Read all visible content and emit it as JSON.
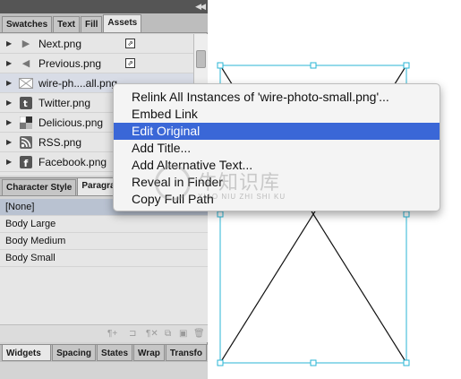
{
  "top_tabs": [
    {
      "label": "Swatches",
      "active": false
    },
    {
      "label": "Text",
      "active": false
    },
    {
      "label": "Fill",
      "active": false
    },
    {
      "label": "Assets",
      "active": true
    }
  ],
  "assets": [
    {
      "label": "Next.png",
      "icon": "play-arrow-icon",
      "linked": true,
      "selected": false
    },
    {
      "label": "Previous.png",
      "icon": "back-arrow-icon",
      "linked": true,
      "selected": false
    },
    {
      "label": "wire-ph....all.png",
      "icon": "image-placeholder-icon",
      "linked": false,
      "selected": true
    },
    {
      "label": "Twitter.png",
      "icon": "twitter-icon",
      "linked": false,
      "selected": false
    },
    {
      "label": "Delicious.png",
      "icon": "delicious-icon",
      "linked": false,
      "selected": false
    },
    {
      "label": "RSS.png",
      "icon": "rss-icon",
      "linked": false,
      "selected": false
    },
    {
      "label": "Facebook.png",
      "icon": "facebook-icon",
      "linked": false,
      "selected": false
    }
  ],
  "style_tabs": [
    {
      "label": "Character Style",
      "active": false
    },
    {
      "label": "Paragraph",
      "active": true
    }
  ],
  "paragraph_styles": [
    {
      "label": "[None]",
      "selected": true
    },
    {
      "label": "Body Large",
      "selected": false
    },
    {
      "label": "Body Medium",
      "selected": false
    },
    {
      "label": "Body Small",
      "selected": false
    }
  ],
  "bottom_tabs": [
    {
      "label": "Widgets Library",
      "active": true
    },
    {
      "label": "Spacing",
      "active": false
    },
    {
      "label": "States",
      "active": false
    },
    {
      "label": "Wrap",
      "active": false
    },
    {
      "label": "Transfo",
      "active": false
    }
  ],
  "context_menu": {
    "items": [
      {
        "label": "Relink All Instances of 'wire-photo-small.png'...",
        "highlighted": false
      },
      {
        "label": "Embed Link",
        "highlighted": false
      },
      {
        "label": "Edit Original",
        "highlighted": true
      },
      {
        "label": "Add Title...",
        "highlighted": false
      },
      {
        "label": "Add Alternative Text...",
        "highlighted": false
      },
      {
        "label": "Reveal in Finder",
        "highlighted": false
      },
      {
        "label": "Copy Full Path",
        "highlighted": false
      }
    ]
  },
  "watermark": {
    "text": "牛知识库",
    "sub": "XIAO NIU ZHI SHI KU"
  },
  "colors": {
    "highlight": "#3a67d7",
    "frame": "#29b6d6"
  }
}
